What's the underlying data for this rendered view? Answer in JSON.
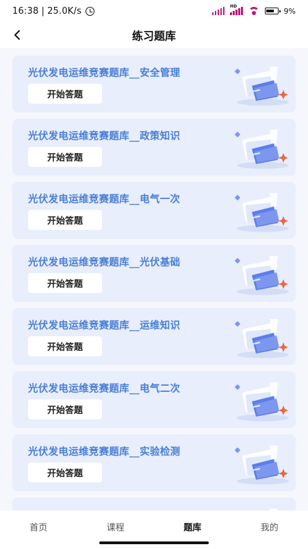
{
  "status_bar": {
    "time": "16:38",
    "network_speed": "25.0K/s",
    "signal_label": "HD",
    "battery": "9%"
  },
  "header": {
    "title": "练习题库"
  },
  "cards": [
    {
      "title": "光伏发电运维竞赛题库__安全管理",
      "button": "开始答题"
    },
    {
      "title": "光伏发电运维竞赛题库__政策知识",
      "button": "开始答题"
    },
    {
      "title": "光伏发电运维竞赛题库__电气一次",
      "button": "开始答题"
    },
    {
      "title": "光伏发电运维竞赛题库__光伏基础",
      "button": "开始答题"
    },
    {
      "title": "光伏发电运维竞赛题库__运维知识",
      "button": "开始答题"
    },
    {
      "title": "光伏发电运维竞赛题库__电气二次",
      "button": "开始答题"
    },
    {
      "title": "光伏发电运维竞赛题库__实验检测",
      "button": "开始答题"
    },
    {
      "title": "",
      "button": ""
    }
  ],
  "bottom_nav": {
    "items": [
      {
        "label": "首页",
        "active": false
      },
      {
        "label": "课程",
        "active": false
      },
      {
        "label": "题库",
        "active": true
      },
      {
        "label": "我的",
        "active": false
      }
    ]
  },
  "colors": {
    "card_bg": "#e8eefb",
    "card_title": "#4a7fd6",
    "page_bg": "#f5f7fc",
    "accent_folder": "#5b7ee8",
    "accent_star": "#f0643c"
  }
}
